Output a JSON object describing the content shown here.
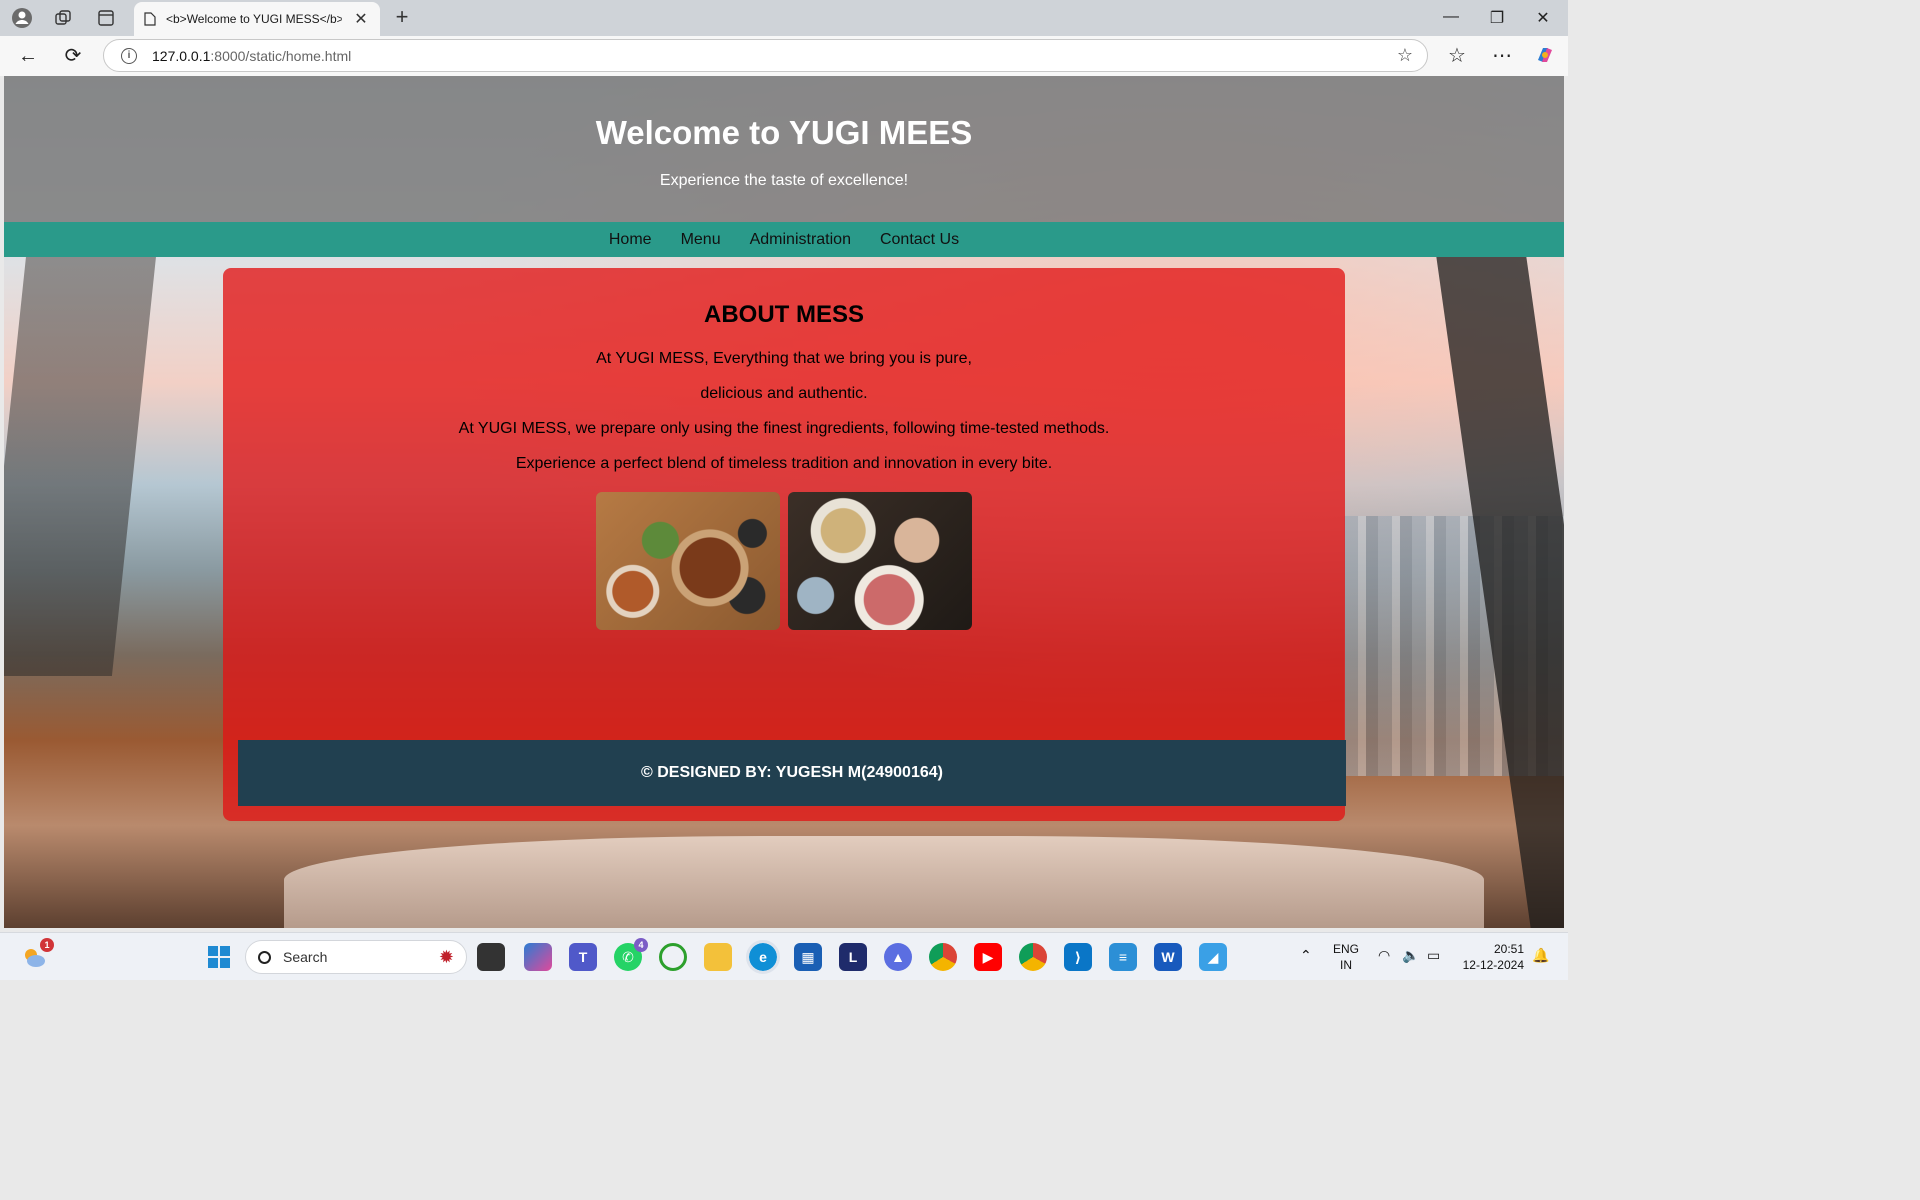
{
  "browser": {
    "tab_title": "<b>Welcome to YUGI MESS</b>",
    "url_host": "127.0.0.1",
    "url_path": ":8000/static/home.html"
  },
  "hero": {
    "title": "Welcome to YUGI MEES",
    "subtitle": "Experience the taste of excellence!"
  },
  "nav": [
    "Home",
    "Menu",
    "Administration",
    "Contact Us"
  ],
  "about": {
    "heading": "ABOUT MESS",
    "lines": [
      "At YUGI MESS, Everything that we bring you is pure,",
      "delicious and authentic.",
      "At YUGI MESS, we prepare only using the finest ingredients, following time-tested methods.",
      "Experience a perfect blend of timeless tradition and innovation in every bite."
    ]
  },
  "footer": {
    "text": "© DESIGNED BY: YUGESH M(24900164)"
  },
  "taskbar": {
    "search_label": "Search",
    "weather_badge": "1",
    "whatsapp_badge": "4",
    "lang_top": "ENG",
    "lang_bottom": "IN",
    "time": "20:51",
    "date": "12-12-2024"
  },
  "colors": {
    "nav_bg": "#2a9a8a",
    "about_bg": "#e11414",
    "footer_bg": "#214050",
    "hero_bg": "#787878"
  }
}
